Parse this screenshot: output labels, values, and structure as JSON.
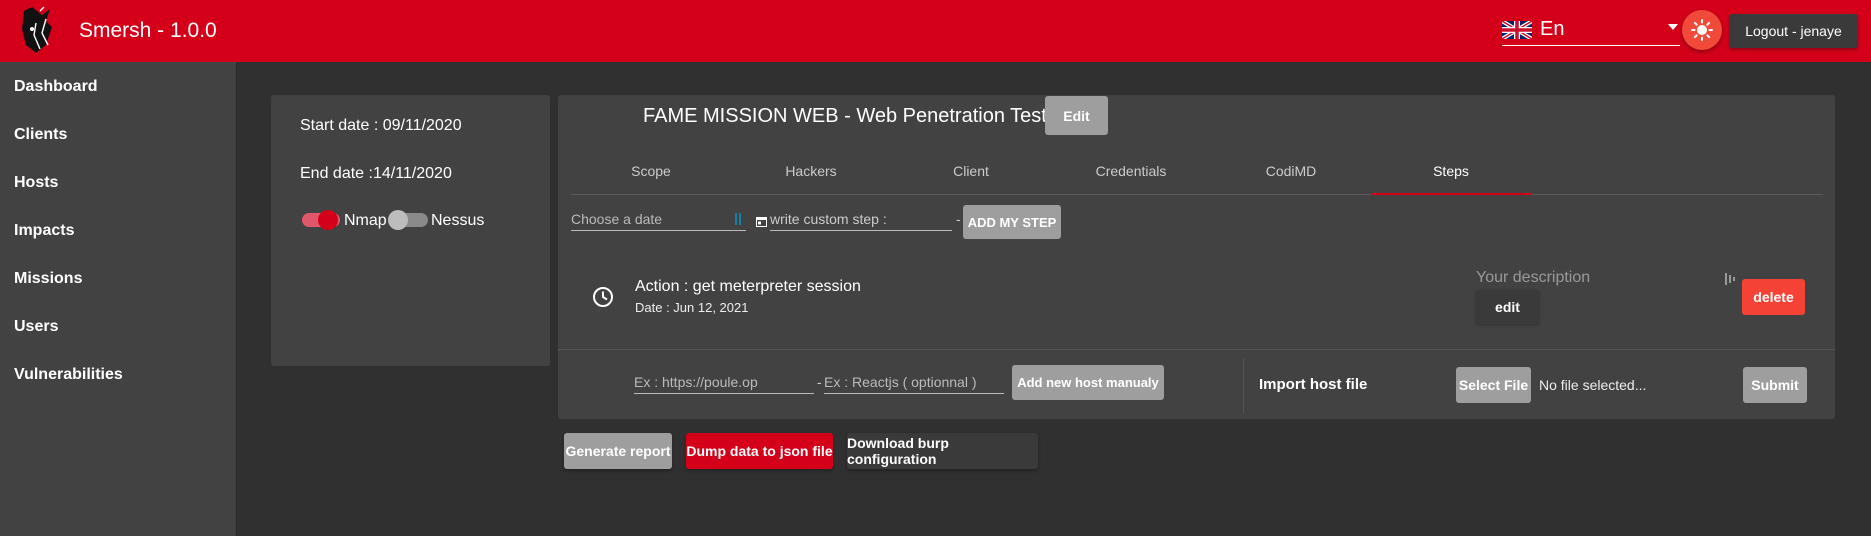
{
  "header": {
    "app_title": "Smersh - 1.0.0",
    "language": "En",
    "logout_label": "Logout - jenaye",
    "brand_color": "#d4001a"
  },
  "sidebar": {
    "items": [
      {
        "label": "Dashboard"
      },
      {
        "label": "Clients"
      },
      {
        "label": "Hosts"
      },
      {
        "label": "Impacts"
      },
      {
        "label": "Missions"
      },
      {
        "label": "Users"
      },
      {
        "label": "Vulnerabilities"
      }
    ]
  },
  "mission": {
    "start_date": "Start date : 09/11/2020",
    "end_date": "End date :14/11/2020",
    "nmap_label": "Nmap",
    "nmap_on": true,
    "nessus_label": "Nessus",
    "nessus_on": false,
    "title": "FAME MISSION WEB - Web Penetration Test",
    "edit_label": "Edit"
  },
  "tabs": [
    {
      "label": "Scope"
    },
    {
      "label": "Hackers"
    },
    {
      "label": "Client"
    },
    {
      "label": "Credentials"
    },
    {
      "label": "CodiMD"
    },
    {
      "label": "Steps",
      "active": true
    }
  ],
  "steps": {
    "date_placeholder": "Choose a date",
    "custom_step_placeholder": "write custom step :",
    "separator": "-",
    "add_label": "ADD MY STEP",
    "items": [
      {
        "action": "Action : get meterpreter session",
        "date": "Date : Jun 12, 2021",
        "description_placeholder": "Your description",
        "edit_label": "edit",
        "delete_label": "delete"
      }
    ]
  },
  "host": {
    "url_placeholder": "Ex : https://poule.op",
    "separator": "-",
    "tech_placeholder": "Ex : Reactjs ( optionnal )",
    "add_label": "Add new host manualy",
    "import_label": "Import host file",
    "select_file_label": "Select File",
    "no_file_text": "No file selected...",
    "submit_label": "Submit"
  },
  "actions": {
    "generate_report": "Generate report",
    "dump_json": "Dump data to json file",
    "download_burp": "Download burp configuration"
  }
}
